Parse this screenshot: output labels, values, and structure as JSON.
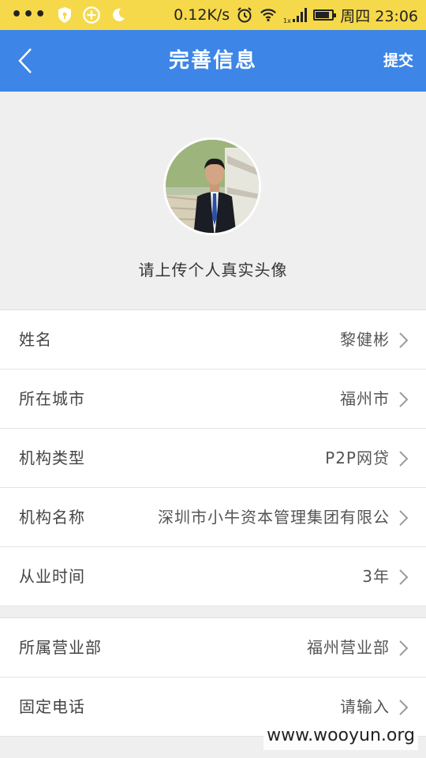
{
  "status_bar": {
    "dots": "•••",
    "speed": "0.12K/s",
    "network_label": "1x",
    "day_time": "周四 23:06",
    "battery_level": 0.85,
    "icons": [
      "shield-icon",
      "plus-circle-icon",
      "moon-icon",
      "alarm-icon",
      "wifi-icon",
      "signal-icon",
      "battery-icon"
    ]
  },
  "header": {
    "title": "完善信息",
    "submit_label": "提交",
    "back_icon": "chevron-left-icon"
  },
  "avatar": {
    "hint": "请上传个人真实头像"
  },
  "form": {
    "fields": [
      {
        "label": "姓名",
        "value": "黎健彬"
      },
      {
        "label": "所在城市",
        "value": "福州市"
      },
      {
        "label": "机构类型",
        "value": "P2P网贷"
      },
      {
        "label": "机构名称",
        "value": "深圳市小牛资本管理集团有限公"
      },
      {
        "label": "从业时间",
        "value": "3年"
      }
    ],
    "fields2": [
      {
        "label": "所属营业部",
        "value": "福州营业部"
      },
      {
        "label": "固定电话",
        "value": "请输入"
      }
    ]
  },
  "watermark": "www.wooyun.org",
  "colors": {
    "status_bar": "#f6d94a",
    "header": "#3d85e6",
    "background": "#efefef"
  }
}
